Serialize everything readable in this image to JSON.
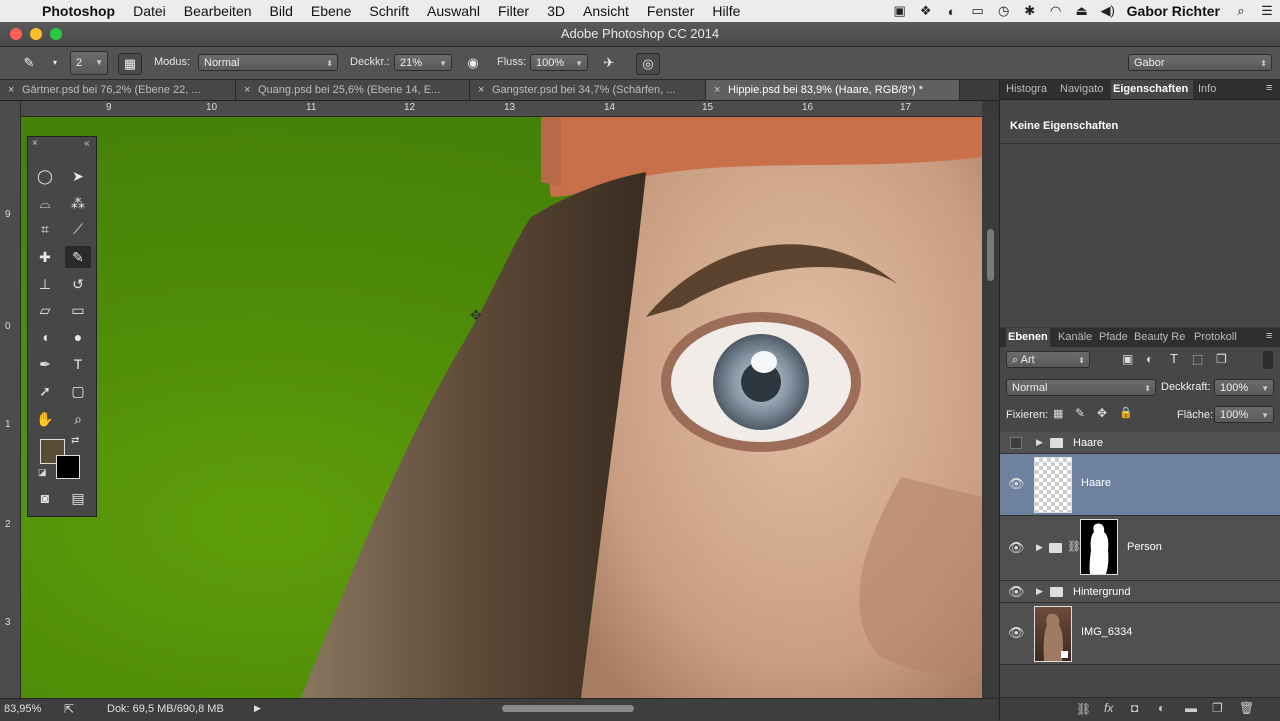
{
  "menubar": {
    "app": "Photoshop",
    "items": [
      "Datei",
      "Bearbeiten",
      "Bild",
      "Ebene",
      "Schrift",
      "Auswahl",
      "Filter",
      "3D",
      "Ansicht",
      "Fenster",
      "Hilfe"
    ],
    "user": "Gabor Richter"
  },
  "window": {
    "title": "Adobe Photoshop CC 2014"
  },
  "options": {
    "brush_size": "2",
    "mode_label": "Modus:",
    "mode_value": "Normal",
    "opacity_label": "Deckkr.:",
    "opacity_value": "21%",
    "flow_label": "Fluss:",
    "flow_value": "100%",
    "workspace": "Gabor"
  },
  "tabs": [
    {
      "label": "Gärtner.psd bei 76,2% (Ebene 22, ..."
    },
    {
      "label": "Quang.psd bei 25,6% (Ebene 14, E..."
    },
    {
      "label": "Gangster.psd bei 34,7% (Schärfen, ..."
    },
    {
      "label": "Hippie.psd bei 83,9% (Haare, RGB/8*) *"
    }
  ],
  "ruler": {
    "top": [
      "9",
      "10",
      "11",
      "12",
      "13",
      "14",
      "15",
      "16",
      "17"
    ],
    "left": [
      "9",
      "0",
      "1",
      "2",
      "3"
    ]
  },
  "status": {
    "zoom": "83,95%",
    "doc": "Dok: 69,5 MB/690,8 MB"
  },
  "panels": {
    "top_tabs": [
      "Histogra",
      "Navigato",
      "Eigenschaften",
      "Info"
    ],
    "properties_text": "Keine Eigenschaften",
    "layers_tabs": [
      "Ebenen",
      "Kanäle",
      "Pfade",
      "Beauty Re",
      "Protokoll"
    ],
    "filter_kind": "Art",
    "blend_mode": "Normal",
    "opacity_label": "Deckkraft:",
    "opacity_value": "100%",
    "lock_label": "Fixieren:",
    "fill_label": "Fläche:",
    "fill_value": "100%",
    "layers": [
      {
        "name": "Haare",
        "type": "group",
        "visible": false
      },
      {
        "name": "Haare",
        "type": "layer",
        "visible": true,
        "selected": true
      },
      {
        "name": "Person",
        "type": "group-mask",
        "visible": true
      },
      {
        "name": "Hintergrund",
        "type": "group",
        "visible": true
      },
      {
        "name": "IMG_6334",
        "type": "smart-object",
        "visible": true
      }
    ]
  },
  "colors": {
    "green_screen": "#4e8b08",
    "selected_layer": "#6e82a0",
    "foreground": "#5a4c36",
    "background": "#000000"
  }
}
